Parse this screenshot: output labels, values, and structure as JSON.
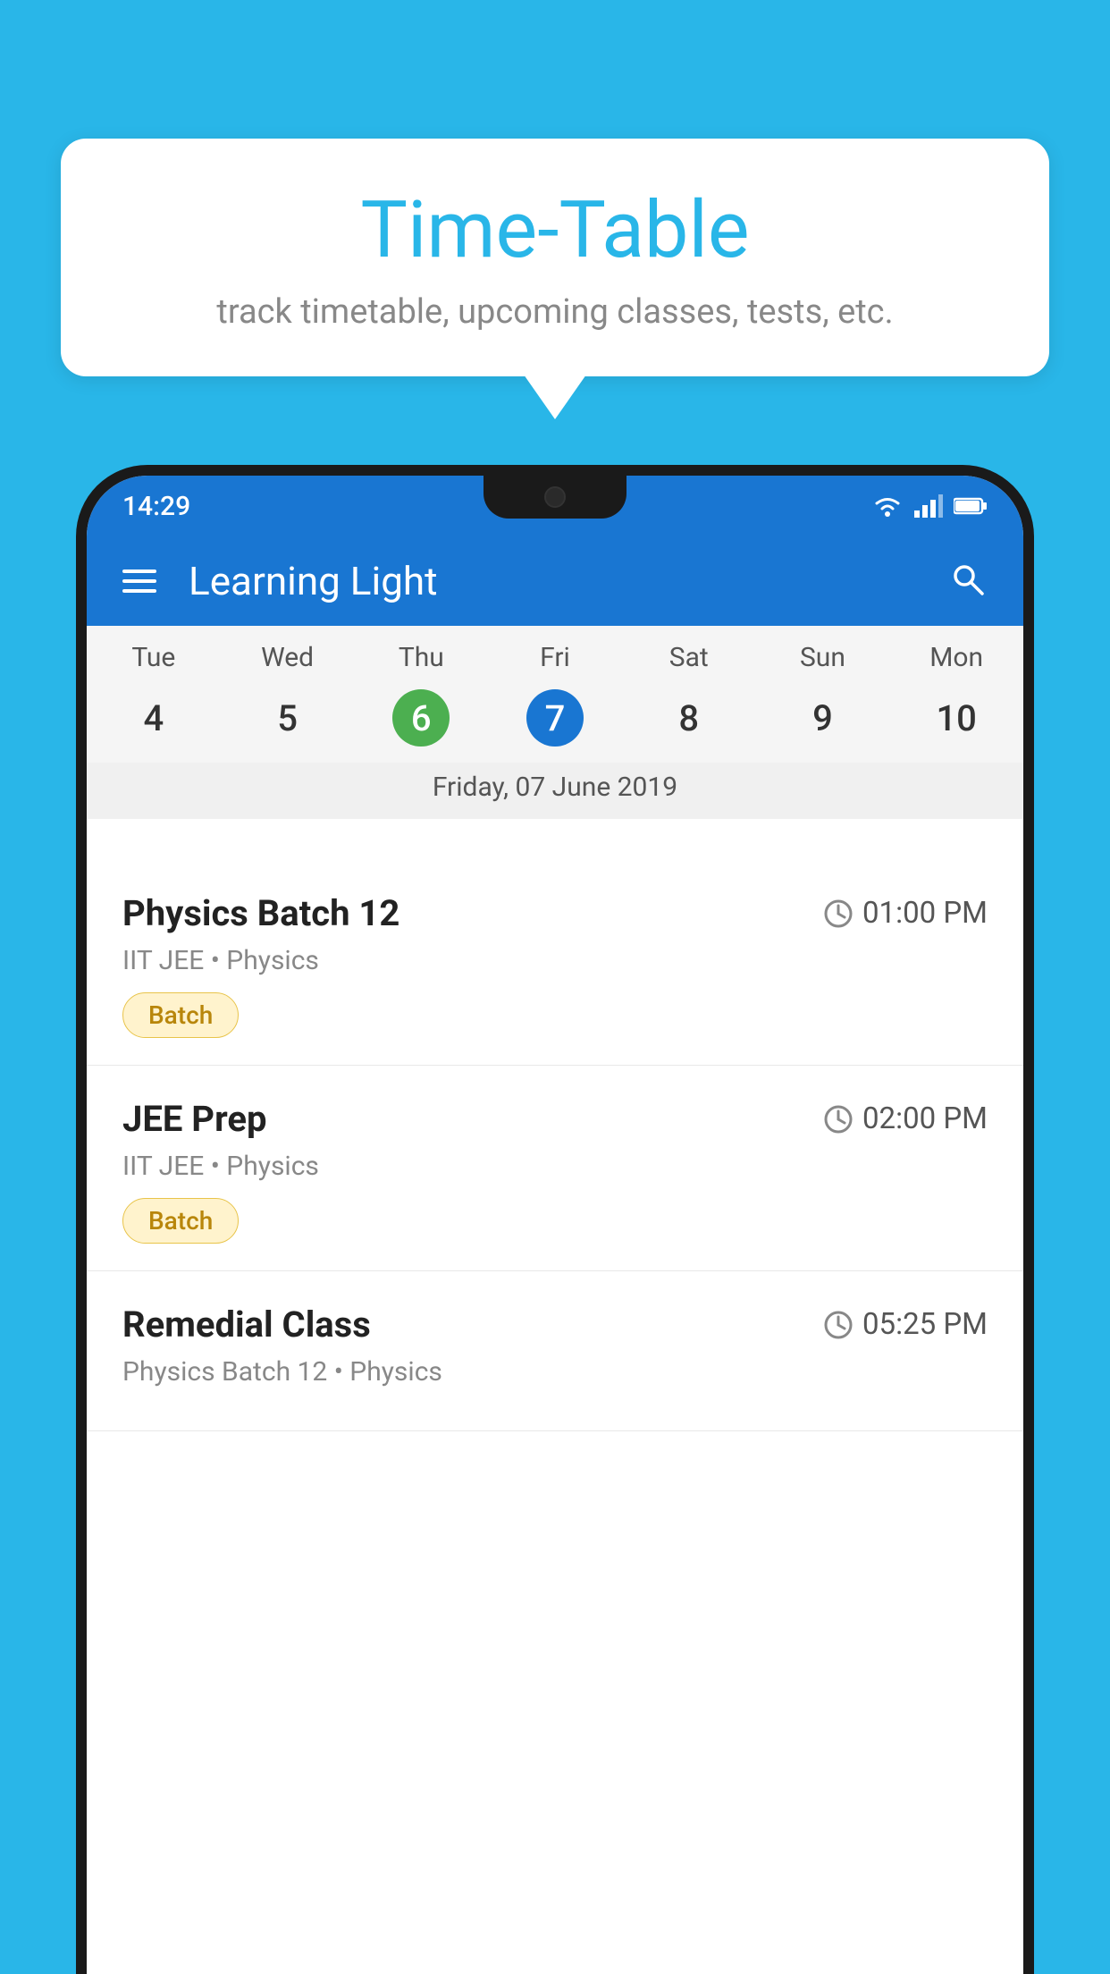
{
  "background_color": "#29b6e8",
  "bubble": {
    "title": "Time-Table",
    "subtitle": "track timetable, upcoming classes, tests, etc."
  },
  "status_bar": {
    "time": "14:29"
  },
  "app_bar": {
    "title": "Learning Light"
  },
  "calendar": {
    "days": [
      {
        "label": "Tue",
        "number": "4"
      },
      {
        "label": "Wed",
        "number": "5"
      },
      {
        "label": "Thu",
        "number": "6",
        "state": "today"
      },
      {
        "label": "Fri",
        "number": "7",
        "state": "selected"
      },
      {
        "label": "Sat",
        "number": "8"
      },
      {
        "label": "Sun",
        "number": "9"
      },
      {
        "label": "Mon",
        "number": "10"
      }
    ],
    "selected_date_label": "Friday, 07 June 2019"
  },
  "schedule": [
    {
      "title": "Physics Batch 12",
      "time": "01:00 PM",
      "meta": "IIT JEE • Physics",
      "tag": "Batch"
    },
    {
      "title": "JEE Prep",
      "time": "02:00 PM",
      "meta": "IIT JEE • Physics",
      "tag": "Batch"
    },
    {
      "title": "Remedial Class",
      "time": "05:25 PM",
      "meta": "Physics Batch 12 • Physics",
      "tag": ""
    }
  ]
}
